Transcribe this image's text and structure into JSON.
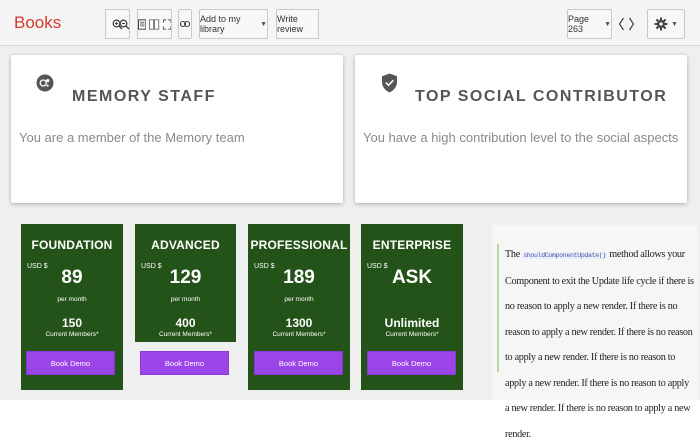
{
  "app": {
    "title": "Books"
  },
  "toolbar": {
    "add_library": "Add to my library",
    "write_review": "Write review",
    "page_label": "Page 263"
  },
  "cards": [
    {
      "title": "MEMORY STAFF",
      "text": "You are a member of the Memory team",
      "icon": "memory-icon"
    },
    {
      "title": "TOP SOCIAL CONTRIBUTOR",
      "text": "You have a high contribution level to the social aspects",
      "icon": "shield-check-icon"
    }
  ],
  "plans": [
    {
      "name": "FOUNDATION",
      "currency": "USD $",
      "price": "89",
      "per": "per month",
      "count": "150",
      "members": "Current Members*",
      "button": "Book Demo"
    },
    {
      "name": "ADVANCED",
      "currency": "USD $",
      "price": "129",
      "per": "per month",
      "count": "400",
      "members": "Current Members*",
      "button": "Book Demo"
    },
    {
      "name": "PROFESSIONAL",
      "currency": "USD $",
      "price": "189",
      "per": "per month",
      "count": "1300",
      "members": "Current Members*",
      "button": "Book Demo"
    },
    {
      "name": "ENTERPRISE",
      "currency": "USD $",
      "price": "ASK",
      "per": "",
      "count": "Unlimited",
      "members": "Current Members*",
      "button": "Book Demo"
    }
  ],
  "doc": {
    "prefix": "The",
    "code": "shouldComponentUpdate()",
    "body": "method allows your Component to exit the Update life cycle if there is no reason to apply a new render. If there is no reason to apply a new render. If there is no reason to apply a new render. If there is no reason to apply a new render. If there is no reason to apply a new render. If there is no reason to apply a new render."
  },
  "colors": {
    "brand": "#d23b2d",
    "plan_bg": "#235318",
    "plan_button": "#9b45e8"
  }
}
